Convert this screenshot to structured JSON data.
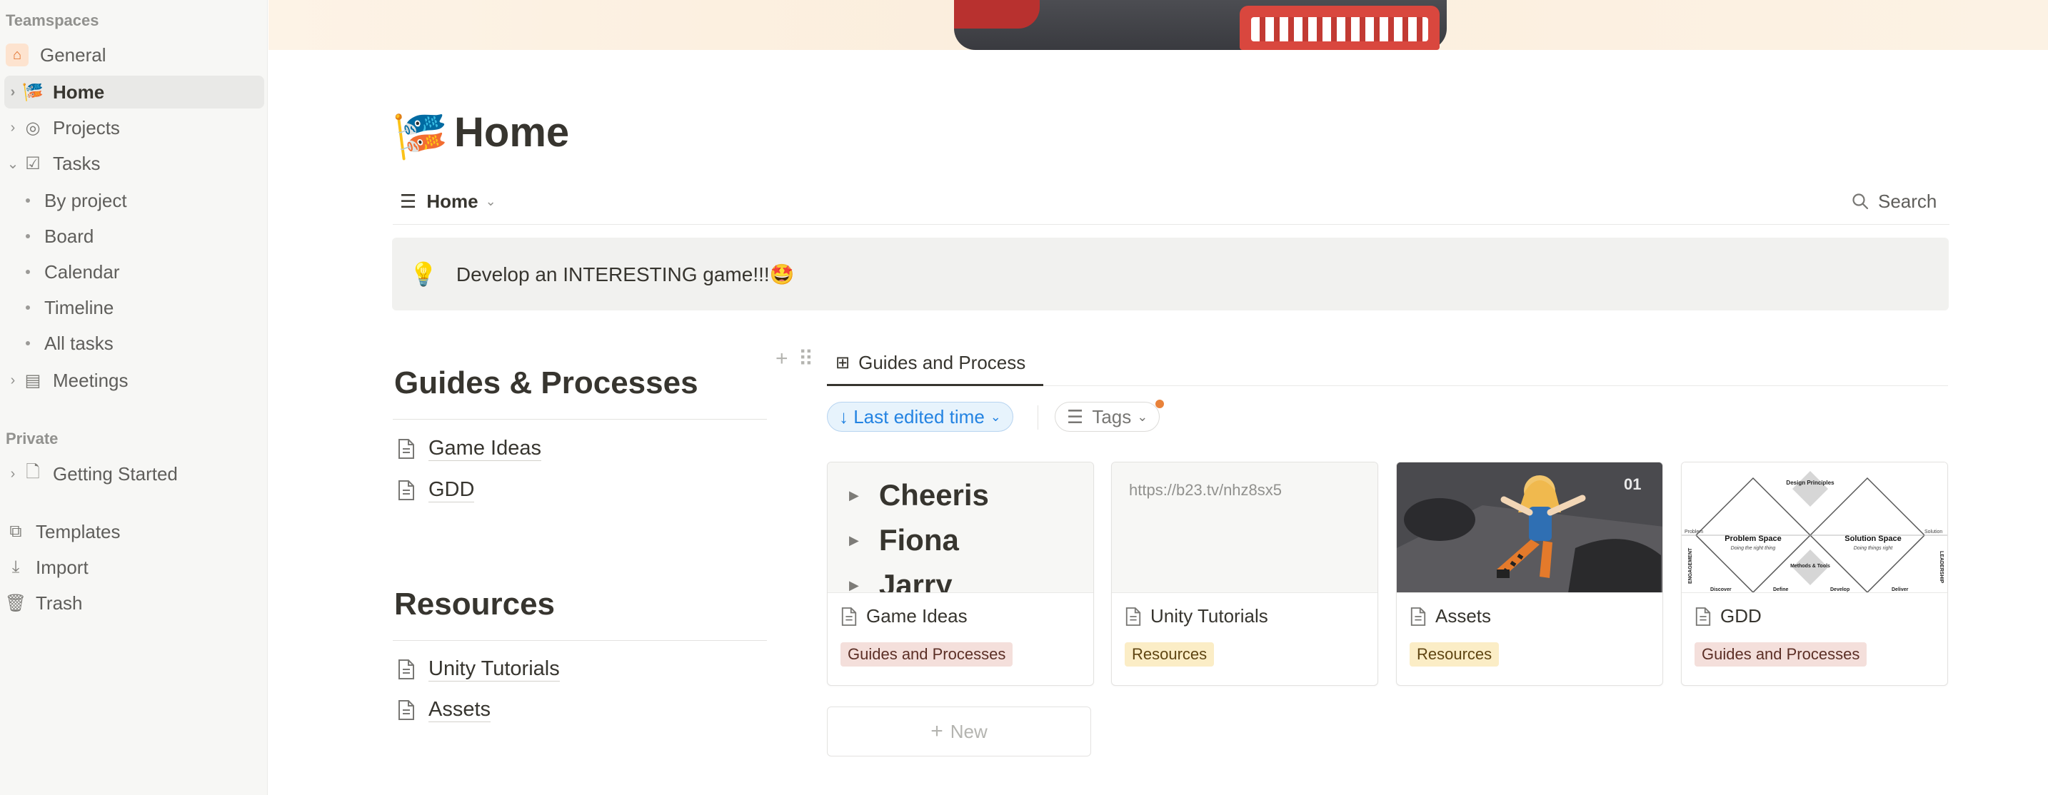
{
  "sidebar": {
    "teamspaces_label": "Teamspaces",
    "general": "General",
    "home": "Home",
    "projects": "Projects",
    "tasks": "Tasks",
    "task_views": [
      "By project",
      "Board",
      "Calendar",
      "Timeline",
      "All tasks"
    ],
    "meetings": "Meetings",
    "private_label": "Private",
    "getting_started": "Getting Started",
    "templates": "Templates",
    "import": "Import",
    "trash": "Trash"
  },
  "page": {
    "icon": "🎏",
    "title": "Home",
    "view_name": "Home",
    "search_label": "Search",
    "callout_icon": "💡",
    "callout_text": "Develop an INTERESTING game!!!🤩"
  },
  "guides": {
    "heading": "Guides & Processes",
    "links": [
      "Game Ideas",
      "GDD"
    ]
  },
  "resources": {
    "heading": "Resources",
    "links": [
      "Unity Tutorials",
      "Assets"
    ]
  },
  "database": {
    "view_tab": "Guides and Process",
    "sort_label": "↓ Last edited time",
    "tags_label": "Tags",
    "new_label": "New",
    "cards": [
      {
        "title": "Game Ideas",
        "tag": "Guides and Processes",
        "preview_items": [
          "Cheeris",
          "Fiona",
          "Jarry"
        ]
      },
      {
        "title": "Unity Tutorials",
        "tag": "Resources",
        "preview_url": "https://b23.tv/nhz8sx5"
      },
      {
        "title": "Assets",
        "tag": "Resources"
      },
      {
        "title": "GDD",
        "tag": "Guides and Processes",
        "diagram_labels": {
          "top": "Design Principles",
          "left": "Problem Space",
          "left_sub": "Doing the right thing",
          "right": "Solution Space",
          "right_sub": "Doing things right",
          "bottom": "Methods & Tools",
          "left_edge": "Problem",
          "right_edge": "Solution",
          "bl": "Discover",
          "bm": "Define",
          "br1": "Develop",
          "br2": "Deliver",
          "side_left": "ENGAGEMENT",
          "side_right": "LEADERSHIP"
        }
      }
    ]
  },
  "colors": {
    "accent": "#2383e2",
    "tag_guides": "#f4dfdb",
    "tag_resources": "#fbedc6",
    "sidebar_bg": "#f7f7f5"
  }
}
